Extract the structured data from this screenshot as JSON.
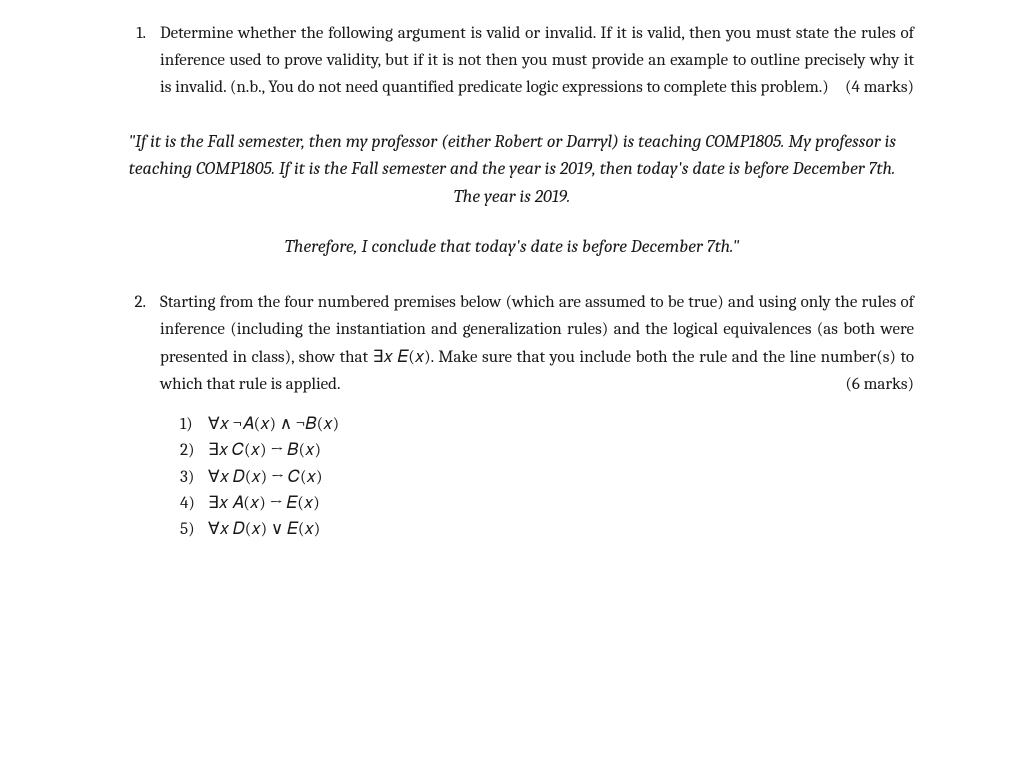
{
  "q1": {
    "number": "1.",
    "text": "Determine whether the following argument is valid or invalid. If it is valid, then you must state the rules of inference used to prove validity, but if it is not then you must provide an example to outline precisely why it is invalid. (n.b., You do not need quantified predicate logic expressions to complete this problem.)",
    "marks": "(4 marks)",
    "quote1": "\"If it is the Fall semester, then my professor (either Robert or Darryl) is teaching COMP1805. My professor is teaching COMP1805. If it is the Fall semester and the year is 2019, then today's date is before December 7th. The year is 2019.",
    "quote2": "Therefore, I conclude that today's date is before December 7th.\""
  },
  "q2": {
    "number": "2.",
    "text_a": "Starting from the four numbered premises below (which are assumed to be true) and using only the rules of inference (including the instantiation and generalization rules) and the logical equivalences (as both were presented in class), show that ",
    "goal": "∃𝑥 𝐸(𝑥)",
    "text_b": ". Make sure that you include both the rule and the line number(s) to which that rule is applied.",
    "marks": "(6 marks)",
    "premises": [
      {
        "n": "1)",
        "expr": "∀𝑥 ¬𝐴(𝑥) ∧ ¬𝐵(𝑥)"
      },
      {
        "n": "2)",
        "expr": "∃𝑥 𝐶(𝑥) → 𝐵(𝑥)"
      },
      {
        "n": "3)",
        "expr": "∀𝑥 𝐷(𝑥) → 𝐶(𝑥)"
      },
      {
        "n": "4)",
        "expr": "∃𝑥 𝐴(𝑥) → 𝐸(𝑥)"
      },
      {
        "n": "5)",
        "expr": "∀𝑥 𝐷(𝑥) ∨ 𝐸(𝑥)"
      }
    ]
  }
}
